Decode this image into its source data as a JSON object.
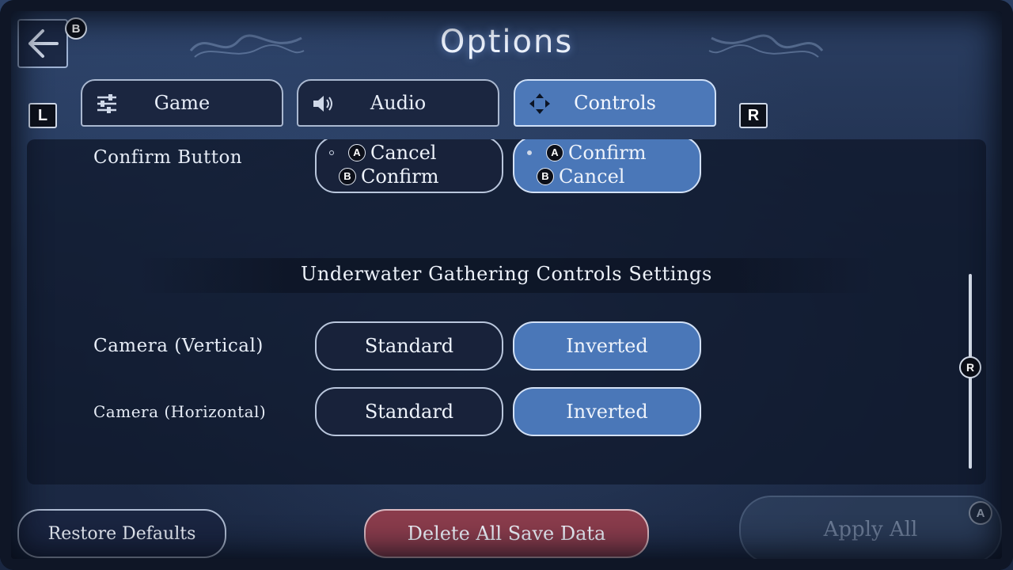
{
  "header": {
    "title": "Options",
    "back_badge": "B"
  },
  "tabs": {
    "left_shoulder": "L",
    "right_shoulder": "R",
    "items": [
      {
        "label": "Game",
        "icon": "sliders-icon"
      },
      {
        "label": "Audio",
        "icon": "speaker-icon"
      },
      {
        "label": "Controls",
        "icon": "dpad-icon",
        "selected": true
      }
    ]
  },
  "settings": {
    "confirm_button": {
      "label": "Confirm Button",
      "option1": {
        "a_key": "A",
        "a_text": "Cancel",
        "b_key": "B",
        "b_text": "Confirm"
      },
      "option2": {
        "a_key": "A",
        "a_text": "Confirm",
        "b_key": "B",
        "b_text": "Cancel",
        "selected": true
      }
    },
    "section_heading": "Underwater Gathering Controls Settings",
    "camera_vertical": {
      "label": "Camera (Vertical)",
      "option1": "Standard",
      "option2": "Inverted",
      "selected": "Inverted"
    },
    "camera_horizontal": {
      "label": "Camera (Horizontal)",
      "option1": "Standard",
      "option2": "Inverted",
      "selected": "Inverted"
    }
  },
  "scrollbar": {
    "badge": "R"
  },
  "footer": {
    "restore_label": "Restore Defaults",
    "delete_label": "Delete All Save Data",
    "apply_label": "Apply All",
    "apply_badge": "A"
  },
  "colors": {
    "selected_blue": "#4a77b8",
    "delete_red": "#8a3c4c",
    "panel_dark": "#18223a"
  }
}
